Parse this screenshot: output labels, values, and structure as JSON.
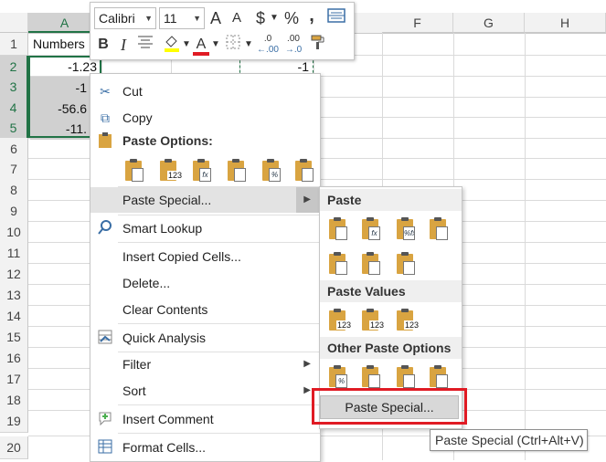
{
  "columns": [
    "A",
    "F",
    "G",
    "H"
  ],
  "rows": [
    "1",
    "2",
    "3",
    "4",
    "5",
    "6",
    "7",
    "8",
    "9",
    "10",
    "11",
    "12",
    "13",
    "14",
    "15",
    "16",
    "17",
    "18",
    "19",
    "20"
  ],
  "cells": {
    "a1": "Numbers",
    "a2": "-1.23",
    "a3": "-1",
    "a4": "-56.6",
    "a5": "-11.",
    "copied": "-1"
  },
  "mini_toolbar": {
    "font_name": "Calibri",
    "font_size": "11",
    "grow_font": "A",
    "shrink_font": "A",
    "currency": "$",
    "percent": "%",
    "comma": ",",
    "bold": "B",
    "italic": "I",
    "font_color": "A",
    "inc_decimal": ".0",
    "dec_decimal": ".00"
  },
  "context_menu": {
    "cut": "Cut",
    "copy": "Copy",
    "paste_options": "Paste Options:",
    "paste_special": "Paste Special...",
    "smart_lookup": "Smart Lookup",
    "insert_copied": "Insert Copied Cells...",
    "delete": "Delete...",
    "clear": "Clear Contents",
    "quick_analysis": "Quick Analysis",
    "filter": "Filter",
    "sort": "Sort",
    "insert_comment": "Insert Comment",
    "format_cells": "Format Cells..."
  },
  "paste_option_tags": [
    "",
    "123",
    "fx",
    "",
    "%",
    ""
  ],
  "submenu": {
    "paste": "Paste",
    "paste_values": "Paste Values",
    "other_paste": "Other Paste Options",
    "paste_special_btn": "Paste Special...",
    "paste_icon_tags": [
      "",
      "fx",
      "%fx",
      "",
      "",
      "",
      ""
    ],
    "value_icon_tags": [
      "123",
      "123",
      "123"
    ],
    "other_icon_tags": [
      "%",
      "",
      "",
      ""
    ]
  },
  "tooltip": "Paste Special (Ctrl+Alt+V)",
  "colors": {
    "accent": "#217346",
    "highlight": "#e01b24",
    "icon": "#d9a441"
  }
}
